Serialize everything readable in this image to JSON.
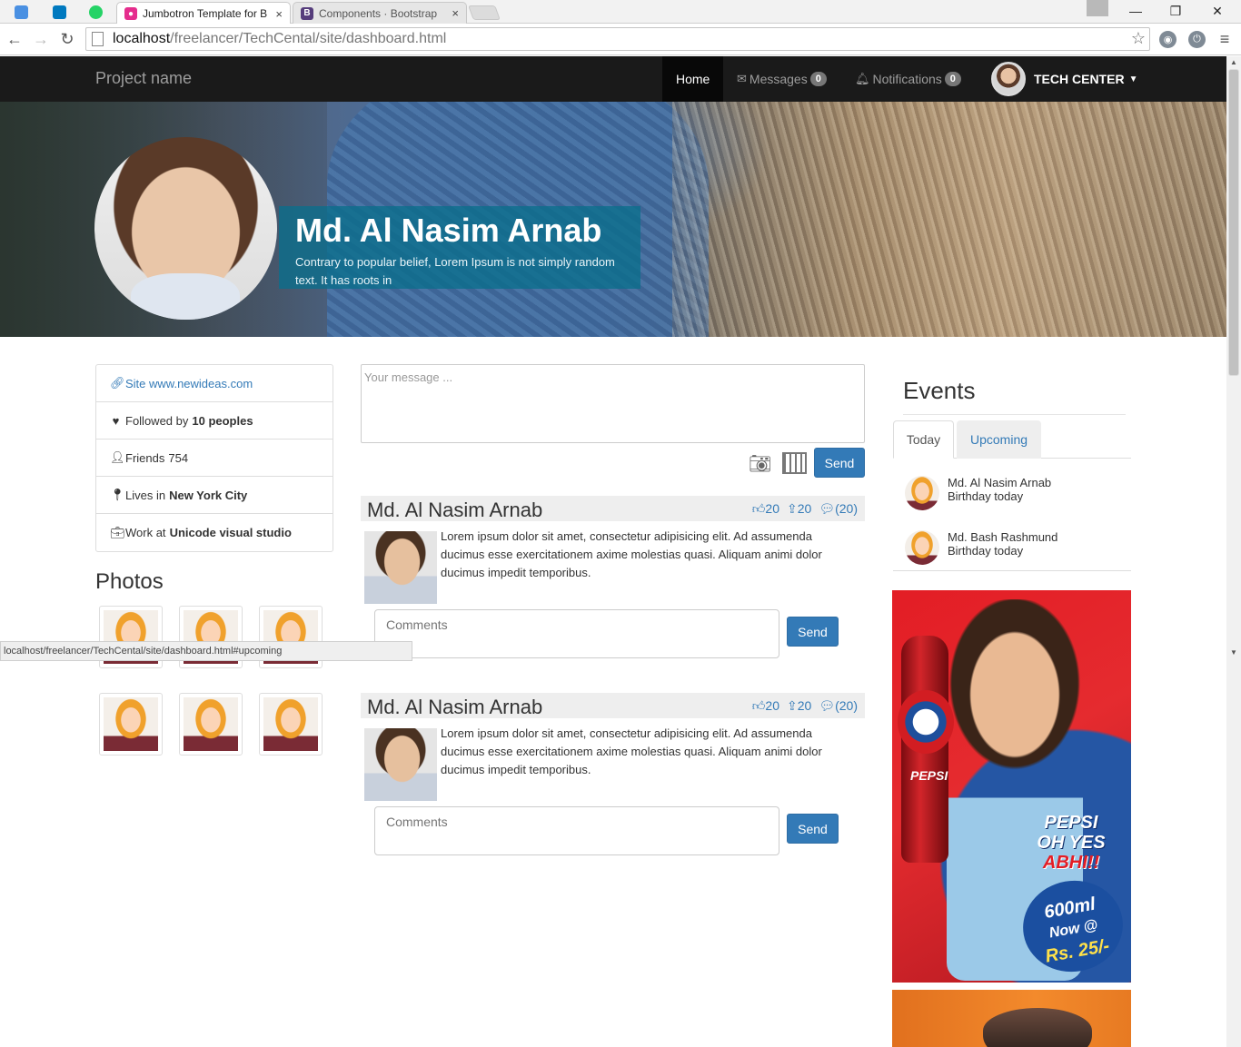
{
  "browser": {
    "tabs": [
      {
        "label": "Jumbotron Template for B",
        "active": true,
        "close": "×"
      },
      {
        "label": "Components · Bootstrap",
        "active": false,
        "close": "×"
      }
    ],
    "address": {
      "host": "localhost",
      "path": "/freelancer/TechCental/site/dashboard.html"
    },
    "status_url": "localhost/freelancer/TechCental/site/dashboard.html#upcoming"
  },
  "navbar": {
    "brand": "Project name",
    "home": "Home",
    "messages": {
      "label": "Messages",
      "count": "0"
    },
    "notifications": {
      "label": "Notifications",
      "count": "0"
    },
    "user": "TECH CENTER"
  },
  "hero": {
    "name": "Md. Al Nasim Arnab",
    "description": "Contrary to popular belief, Lorem Ipsum is not simply random text. It has roots in"
  },
  "profile": {
    "site": "Site www.newideas.com",
    "followed_prefix": "Followed by",
    "followed_value": "10 peoples",
    "friends_prefix": "Friends",
    "friends_value": "754",
    "lives_prefix": "Lives in",
    "lives_value": "New York City",
    "work_prefix": "Work at",
    "work_value": "Unicode visual studio"
  },
  "photos_title": "Photos",
  "composer": {
    "placeholder": "Your message ...",
    "send": "Send"
  },
  "posts": [
    {
      "author": "Md. Al Nasim Arnab",
      "likes": "20",
      "shares": "20",
      "comments": "(20)",
      "text": "Lorem ipsum dolor sit amet, consectetur adipisicing elit. Ad assumenda ducimus esse exercitationem axime molestias quasi. Aliquam animi dolor ducimus impedit temporibus.",
      "comment_placeholder": "Comments",
      "send": "Send"
    },
    {
      "author": "Md. Al Nasim Arnab",
      "likes": "20",
      "shares": "20",
      "comments": "(20)",
      "text": "Lorem ipsum dolor sit amet, consectetur adipisicing elit. Ad assumenda ducimus esse exercitationem axime molestias quasi. Aliquam animi dolor ducimus impedit temporibus.",
      "comment_placeholder": "Comments",
      "send": "Send"
    }
  ],
  "events": {
    "title": "Events",
    "tabs": {
      "today": "Today",
      "upcoming": "Upcoming"
    },
    "items": [
      {
        "name": "Md. Al Nasim Arnab",
        "note": "Birthday today"
      },
      {
        "name": "Md. Bash Rashmund",
        "note": "Birthday today"
      }
    ]
  },
  "ad": {
    "brand": "PEPSI",
    "line1": "PEPSI",
    "line2": "OH YES",
    "line3": "ABHI!!",
    "size": "600ml",
    "now": "Now @",
    "price": "Rs. 25/-"
  },
  "colors": {
    "primary": "#337ab7",
    "navbar": "#1a1a1a",
    "hero_box": "#0a6e8c"
  }
}
